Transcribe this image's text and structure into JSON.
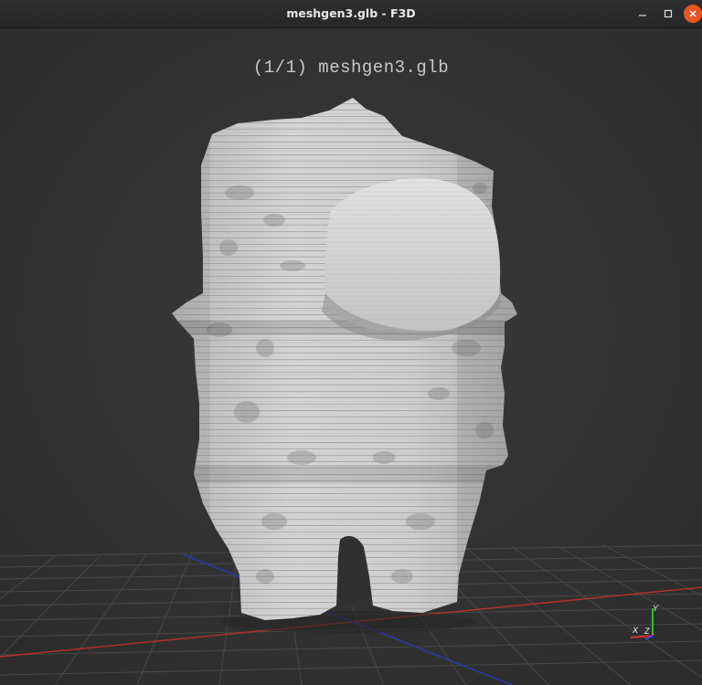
{
  "window": {
    "title": "meshgen3.glb - F3D",
    "buttons": {
      "minimize_icon": "minimize-icon",
      "maximize_icon": "maximize-icon",
      "close_icon": "close-icon",
      "close_color": "#e95420"
    }
  },
  "viewport": {
    "filename_overlay": "(1/1) meshgen3.glb",
    "background_color": "#333333",
    "grid_color": "#4a4a4a",
    "x_axis_color": "#b03030",
    "z_axis_color": "#2a3aa8",
    "model_color": "#cfcfcf"
  },
  "axes_widget": {
    "x_label": "X",
    "y_label": "Y",
    "z_label": "Z",
    "x_color": "#e03030",
    "y_color": "#30c030",
    "z_color": "#3050e0"
  }
}
